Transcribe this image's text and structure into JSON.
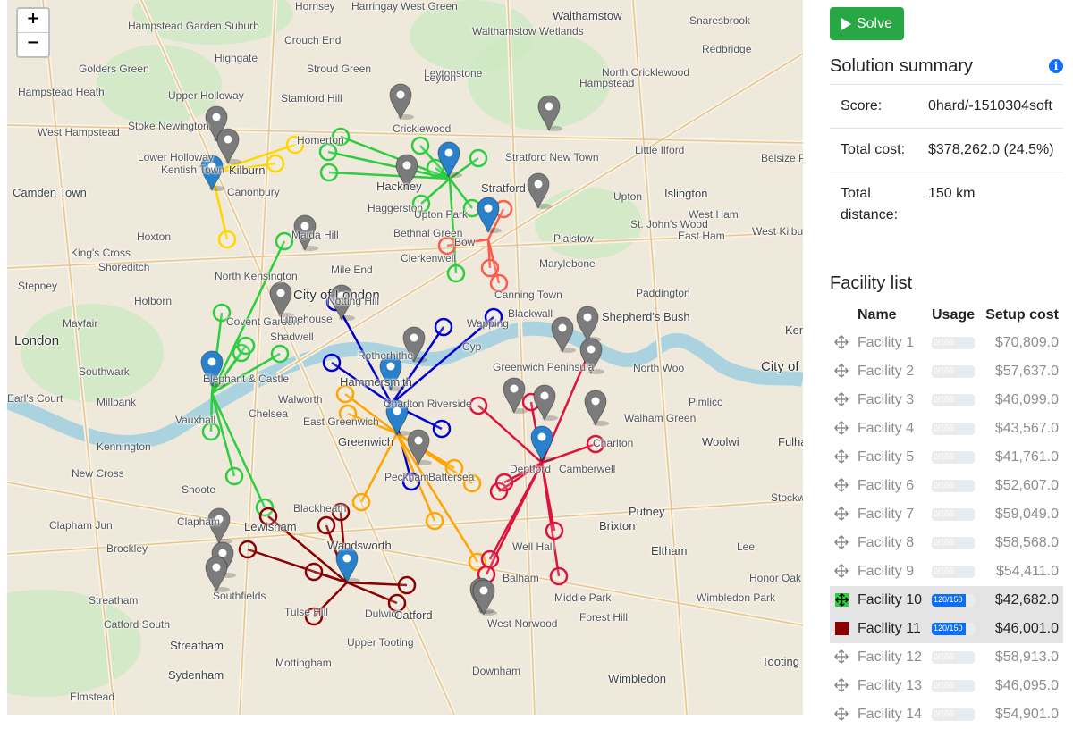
{
  "map": {
    "zoom_in_label": "+",
    "zoom_out_label": "−",
    "place_labels": [
      {
        "text": "Hornsey",
        "cls": ""
      },
      {
        "text": "Harringay",
        "cls": ""
      },
      {
        "text": "West Green",
        "cls": ""
      },
      {
        "text": "Walthamstow",
        "cls": "mid"
      },
      {
        "text": "Snaresbrook",
        "cls": ""
      },
      {
        "text": "Hampstead Garden Suburb",
        "cls": ""
      },
      {
        "text": "Crouch End",
        "cls": ""
      },
      {
        "text": "Walthamstow Wetlands",
        "cls": ""
      },
      {
        "text": "Redbridge",
        "cls": ""
      },
      {
        "text": "Golders Green",
        "cls": ""
      },
      {
        "text": "Highgate",
        "cls": ""
      },
      {
        "text": "Stroud Green",
        "cls": ""
      },
      {
        "text": "Leytonstone",
        "cls": ""
      },
      {
        "text": "North Cricklewood",
        "cls": ""
      },
      {
        "text": "Hampstead Heath",
        "cls": ""
      },
      {
        "text": "Upper Holloway",
        "cls": ""
      },
      {
        "text": "Stamford Hill",
        "cls": ""
      },
      {
        "text": "Leyton",
        "cls": ""
      },
      {
        "text": "Hampstead",
        "cls": ""
      },
      {
        "text": "Stoke Newington",
        "cls": ""
      },
      {
        "text": "Cricklewood",
        "cls": ""
      },
      {
        "text": "West Hampstead",
        "cls": ""
      },
      {
        "text": "Lower Holloway",
        "cls": ""
      },
      {
        "text": "Homerton",
        "cls": ""
      },
      {
        "text": "Stratford New Town",
        "cls": ""
      },
      {
        "text": "Little Ilford",
        "cls": ""
      },
      {
        "text": "Belsize Park",
        "cls": ""
      },
      {
        "text": "Kentish Town",
        "cls": ""
      },
      {
        "text": "Kilburn",
        "cls": "mid"
      },
      {
        "text": "Camden Town",
        "cls": "mid"
      },
      {
        "text": "Canonbury",
        "cls": ""
      },
      {
        "text": "Hackney",
        "cls": "mid"
      },
      {
        "text": "Stratford",
        "cls": "mid"
      },
      {
        "text": "Upton",
        "cls": ""
      },
      {
        "text": "Islington",
        "cls": "mid"
      },
      {
        "text": "Haggerston",
        "cls": ""
      },
      {
        "text": "Upton Park",
        "cls": ""
      },
      {
        "text": "West Ham",
        "cls": ""
      },
      {
        "text": "St. John's Wood",
        "cls": ""
      },
      {
        "text": "Hoxton",
        "cls": ""
      },
      {
        "text": "Bethnal Green",
        "cls": ""
      },
      {
        "text": "Bow",
        "cls": ""
      },
      {
        "text": "Plaistow",
        "cls": ""
      },
      {
        "text": "East Ham",
        "cls": ""
      },
      {
        "text": "West Kilburn",
        "cls": ""
      },
      {
        "text": "King's Cross",
        "cls": ""
      },
      {
        "text": "Maida Hill",
        "cls": ""
      },
      {
        "text": "Shoreditch",
        "cls": ""
      },
      {
        "text": "Clerkenwell",
        "cls": ""
      },
      {
        "text": "Mile End",
        "cls": ""
      },
      {
        "text": "Marylebone",
        "cls": ""
      },
      {
        "text": "North Kensington",
        "cls": ""
      },
      {
        "text": "Stepney",
        "cls": ""
      },
      {
        "text": "Canning Town",
        "cls": ""
      },
      {
        "text": "Paddington",
        "cls": ""
      },
      {
        "text": "Holborn",
        "cls": ""
      },
      {
        "text": "City of London",
        "cls": "big"
      },
      {
        "text": "Notting Hill",
        "cls": ""
      },
      {
        "text": "Mayfair",
        "cls": ""
      },
      {
        "text": "Covent Garden",
        "cls": ""
      },
      {
        "text": "Limehouse",
        "cls": ""
      },
      {
        "text": "Blackwall",
        "cls": ""
      },
      {
        "text": "Shepherd's Bush",
        "cls": "mid"
      },
      {
        "text": "London",
        "cls": "big"
      },
      {
        "text": "Shadwell",
        "cls": ""
      },
      {
        "text": "Wapping",
        "cls": ""
      },
      {
        "text": "Cyp",
        "cls": ""
      },
      {
        "text": "Kensington",
        "cls": "mid"
      },
      {
        "text": "Southwark",
        "cls": ""
      },
      {
        "text": "Rotherhithe",
        "cls": ""
      },
      {
        "text": "Greenwich Peninsula",
        "cls": ""
      },
      {
        "text": "North Woo",
        "cls": ""
      },
      {
        "text": "City of Westminster",
        "cls": "big"
      },
      {
        "text": "Elephant & Castle",
        "cls": ""
      },
      {
        "text": "Hammersmith",
        "cls": "mid"
      },
      {
        "text": "Earl's Court",
        "cls": ""
      },
      {
        "text": "Millbank",
        "cls": ""
      },
      {
        "text": "Walworth",
        "cls": ""
      },
      {
        "text": "Charlton Riverside",
        "cls": ""
      },
      {
        "text": "Pimlico",
        "cls": ""
      },
      {
        "text": "Chelsea",
        "cls": ""
      },
      {
        "text": "Vauxhall",
        "cls": ""
      },
      {
        "text": "East Greenwich",
        "cls": ""
      },
      {
        "text": "Walham Green",
        "cls": ""
      },
      {
        "text": "Kennington",
        "cls": ""
      },
      {
        "text": "Greenwich",
        "cls": "mid"
      },
      {
        "text": "Charlton",
        "cls": ""
      },
      {
        "text": "Woolwi",
        "cls": "mid"
      },
      {
        "text": "Fulham",
        "cls": "mid"
      },
      {
        "text": "New Cross",
        "cls": ""
      },
      {
        "text": "Deptford",
        "cls": ""
      },
      {
        "text": "Camberwell",
        "cls": ""
      },
      {
        "text": "Peckham",
        "cls": ""
      },
      {
        "text": "Battersea",
        "cls": ""
      },
      {
        "text": "Shoote",
        "cls": ""
      },
      {
        "text": "Stockwell",
        "cls": ""
      },
      {
        "text": "Blackheath",
        "cls": ""
      },
      {
        "text": "Putney",
        "cls": "mid"
      },
      {
        "text": "Clapham Jun",
        "cls": ""
      },
      {
        "text": "Clapham",
        "cls": ""
      },
      {
        "text": "Lewisham",
        "cls": "mid"
      },
      {
        "text": "Brixton",
        "cls": "mid"
      },
      {
        "text": "Wandsworth",
        "cls": "mid"
      },
      {
        "text": "Brockley",
        "cls": ""
      },
      {
        "text": "Well Hall",
        "cls": ""
      },
      {
        "text": "Lee",
        "cls": ""
      },
      {
        "text": "Eltham",
        "cls": "mid"
      },
      {
        "text": "Honor Oak",
        "cls": ""
      },
      {
        "text": "Balham",
        "cls": ""
      },
      {
        "text": "Southfields",
        "cls": ""
      },
      {
        "text": "Streatham",
        "cls": ""
      },
      {
        "text": "Tulse Hill",
        "cls": ""
      },
      {
        "text": "Dulwich",
        "cls": ""
      },
      {
        "text": "Catford",
        "cls": "mid"
      },
      {
        "text": "Middle Park",
        "cls": ""
      },
      {
        "text": "Wimbledon Park",
        "cls": ""
      },
      {
        "text": "Catford South",
        "cls": ""
      },
      {
        "text": "Forest Hill",
        "cls": ""
      },
      {
        "text": "West Norwood",
        "cls": ""
      },
      {
        "text": "Upper Tooting",
        "cls": ""
      },
      {
        "text": "Streatham",
        "cls": "mid"
      },
      {
        "text": "Mottingham",
        "cls": ""
      },
      {
        "text": "Tooting",
        "cls": "mid"
      },
      {
        "text": "Sydenham",
        "cls": "mid"
      },
      {
        "text": "Downham",
        "cls": ""
      },
      {
        "text": "Wimbledon",
        "cls": "mid"
      },
      {
        "text": "Elmstead",
        "cls": ""
      }
    ]
  },
  "panel": {
    "solve_label": "Solve",
    "summary_title": "Solution summary",
    "info_icon_glyph": "i",
    "summary": [
      {
        "key": "Score:",
        "value": "0hard/-1510304soft"
      },
      {
        "key": "Total cost:",
        "value": "$378,262.0 (24.5%)"
      },
      {
        "key": "Total distance:",
        "value": "150 km"
      }
    ],
    "facility_title": "Facility list",
    "headers": {
      "name": "Name",
      "usage": "Usage",
      "cost": "Setup cost"
    },
    "facilities": [
      {
        "name": "Facility 1",
        "usage_text": "0/150",
        "usage_fraction": 0,
        "cost": "$70,809.0",
        "selected": false,
        "color": ""
      },
      {
        "name": "Facility 2",
        "usage_text": "0/150",
        "usage_fraction": 0,
        "cost": "$57,637.0",
        "selected": false,
        "color": ""
      },
      {
        "name": "Facility 3",
        "usage_text": "0/150",
        "usage_fraction": 0,
        "cost": "$46,099.0",
        "selected": false,
        "color": ""
      },
      {
        "name": "Facility 4",
        "usage_text": "0/150",
        "usage_fraction": 0,
        "cost": "$43,567.0",
        "selected": false,
        "color": ""
      },
      {
        "name": "Facility 5",
        "usage_text": "0/150",
        "usage_fraction": 0,
        "cost": "$41,761.0",
        "selected": false,
        "color": ""
      },
      {
        "name": "Facility 6",
        "usage_text": "0/150",
        "usage_fraction": 0,
        "cost": "$52,607.0",
        "selected": false,
        "color": ""
      },
      {
        "name": "Facility 7",
        "usage_text": "0/150",
        "usage_fraction": 0,
        "cost": "$59,049.0",
        "selected": false,
        "color": ""
      },
      {
        "name": "Facility 8",
        "usage_text": "0/150",
        "usage_fraction": 0,
        "cost": "$58,568.0",
        "selected": false,
        "color": ""
      },
      {
        "name": "Facility 9",
        "usage_text": "0/150",
        "usage_fraction": 0,
        "cost": "$54,411.0",
        "selected": false,
        "color": ""
      },
      {
        "name": "Facility 10",
        "usage_text": "120/150",
        "usage_fraction": 0.8,
        "cost": "$42,682.0",
        "selected": true,
        "color": "#2ecc40"
      },
      {
        "name": "Facility 11",
        "usage_text": "120/150",
        "usage_fraction": 0.8,
        "cost": "$46,001.0",
        "selected": true,
        "color": "#8b0000"
      },
      {
        "name": "Facility 12",
        "usage_text": "0/150",
        "usage_fraction": 0,
        "cost": "$58,913.0",
        "selected": false,
        "color": ""
      },
      {
        "name": "Facility 13",
        "usage_text": "0/150",
        "usage_fraction": 0,
        "cost": "$46,095.0",
        "selected": false,
        "color": ""
      },
      {
        "name": "Facility 14",
        "usage_text": "0/150",
        "usage_fraction": 0,
        "cost": "$54,901.0",
        "selected": false,
        "color": ""
      }
    ]
  },
  "colors": {
    "solve_button": "#28a745",
    "usage_bar": "#0d6efd",
    "yellow": "#ffd700",
    "green": "#2ecc40",
    "red": "#ff5a4a",
    "blue": "#0000cd",
    "orange": "#ffa500",
    "crimson": "#dc143c",
    "darkred": "#8b0000",
    "marker_blue": "#2a81cb",
    "marker_grey": "#7b7b7b"
  }
}
